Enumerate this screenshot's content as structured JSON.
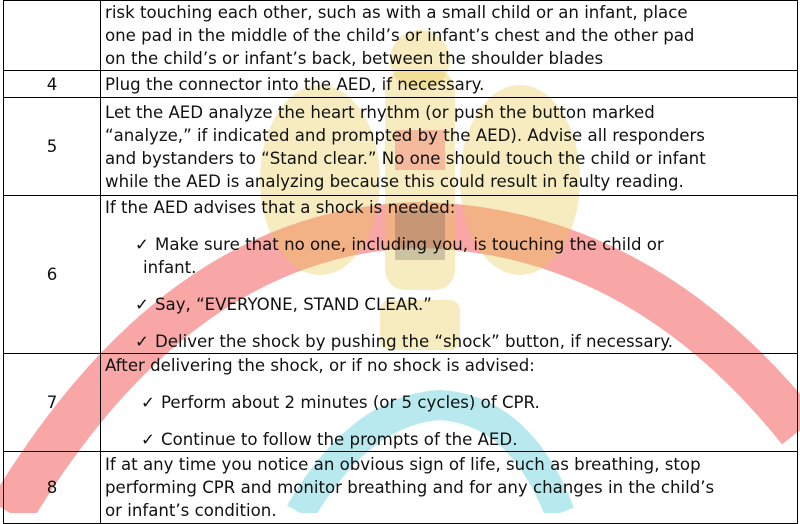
{
  "continuation": {
    "lines": [
      "risk touching each other, such as with a small child or an infant, place",
      "one pad in the middle of the child’s or infant’s chest and the other pad",
      "on the child’s or infant’s back, between the shoulder blades"
    ]
  },
  "steps": [
    {
      "number": "4",
      "lines": [
        "Plug the connector into the AED, if necessary."
      ]
    },
    {
      "number": "5",
      "lines": [
        "Let the AED analyze the heart rhythm (or push the button marked",
        "“analyze,” if indicated and prompted by the AED). Advise all responders",
        "and bystanders to “Stand clear.” No one should touch the child or infant",
        "while the AED is analyzing because this could result in faulty reading."
      ]
    },
    {
      "number": "6",
      "intro": "If the AED advises that a shock is needed:",
      "checks": [
        {
          "line1": "Make sure that no one, including you, is touching the child or",
          "line2": "infant."
        },
        {
          "line1": "Say, “EVERYONE, STAND CLEAR.”"
        },
        {
          "line1": "Deliver the shock by pushing the “shock” button, if necessary."
        }
      ]
    },
    {
      "number": "7",
      "intro": "After delivering the shock, or if no shock is advised:",
      "checks": [
        {
          "line1": "Perform about 2 minutes (or 5 cycles) of CPR."
        },
        {
          "line1": "Continue to follow the prompts of the AED."
        }
      ]
    },
    {
      "number": "8",
      "lines": [
        "If at any time you notice an obvious sign of life, such as breathing, stop",
        "performing CPR and monitor breathing and for any changes in the child’s",
        "or infant’s condition."
      ]
    }
  ],
  "check_glyph": "✓",
  "watermark": {
    "icon": "egypt-eagle-emblem",
    "colors": {
      "red": "#f25c5c",
      "gold": "#e8c94a",
      "teal": "#6fd3df"
    }
  }
}
